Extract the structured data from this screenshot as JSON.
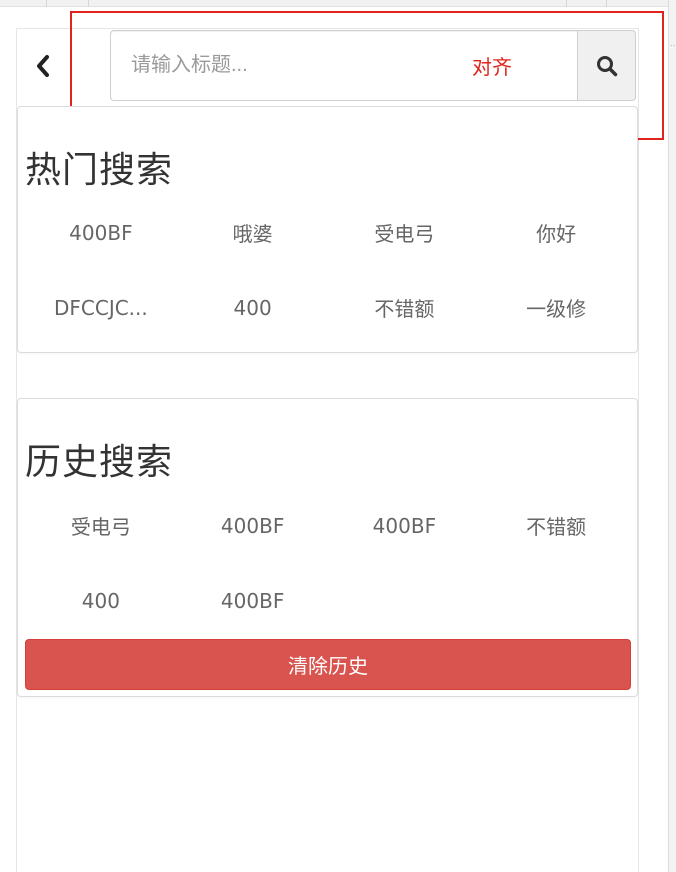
{
  "search": {
    "placeholder": "请输入标题...",
    "annotation_label": "对齐"
  },
  "icons": {
    "back": "chevron-left-icon",
    "search": "search-icon"
  },
  "hot_search": {
    "title": "热门搜索",
    "tags": [
      "400BF",
      "哦婆",
      "受电弓",
      "你好",
      "DFCCJC...",
      "400",
      "不错额",
      "一级修"
    ]
  },
  "history_search": {
    "title": "历史搜索",
    "tags": [
      "受电弓",
      "400BF",
      "400BF",
      "不错额",
      "400",
      "400BF"
    ],
    "clear_label": "清除历史"
  },
  "colors": {
    "danger": "#d9534f",
    "annotation": "#e0241b"
  }
}
